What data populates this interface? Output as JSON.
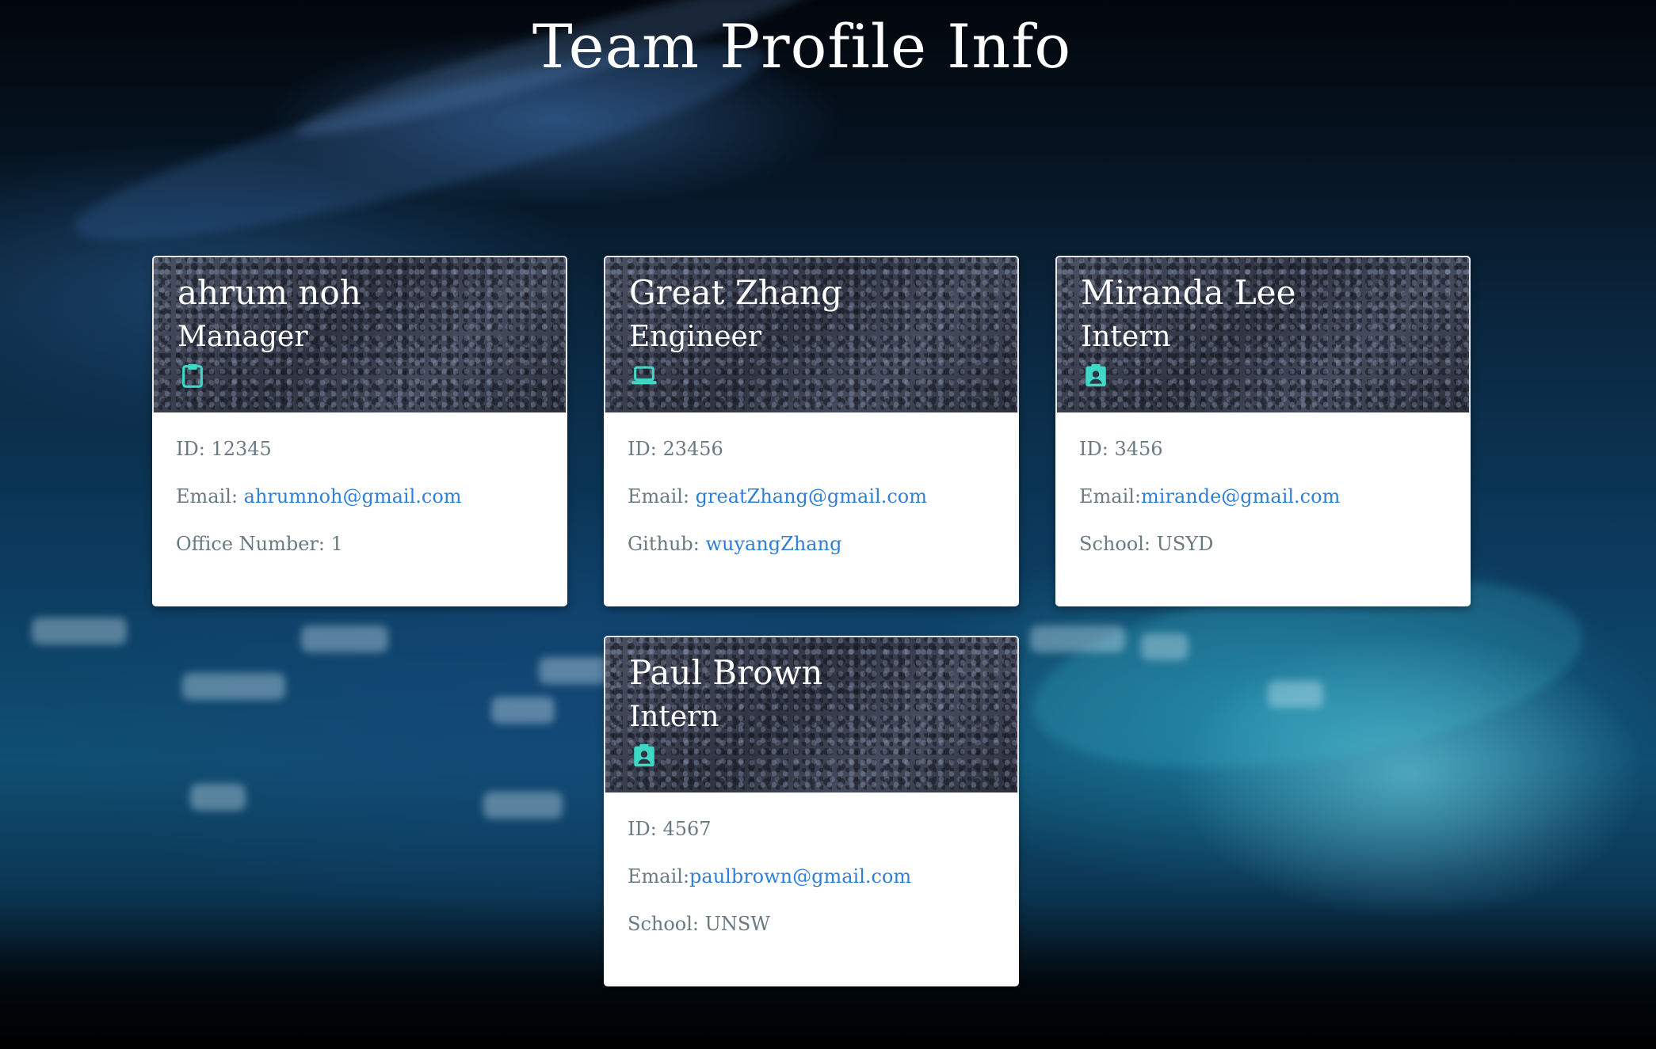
{
  "page": {
    "title": "Team Profile Info"
  },
  "theme": {
    "icon_color": "#3dd9c6",
    "link_color": "#2f7fd6",
    "text_color": "#6a7a82"
  },
  "cards": [
    {
      "name": "ahrum noh",
      "role": "Manager",
      "icon": "clipboard-icon",
      "id_label": "ID: 12345",
      "email_prefix": "Email: ",
      "email": "ahrumnoh@gmail.com",
      "extra_prefix": "Office Number: 1",
      "extra_value": ""
    },
    {
      "name": "Great Zhang",
      "role": "Engineer",
      "icon": "laptop-icon",
      "id_label": "ID: 23456",
      "email_prefix": "Email: ",
      "email": "greatZhang@gmail.com",
      "extra_prefix": "Github: ",
      "extra_value": "wuyangZhang"
    },
    {
      "name": "Miranda Lee",
      "role": "Intern",
      "icon": "badge-icon",
      "id_label": "ID: 3456",
      "email_prefix": "Email:",
      "email": "mirande@gmail.com",
      "extra_prefix": "School: USYD",
      "extra_value": ""
    },
    {
      "name": "Paul Brown",
      "role": "Intern",
      "icon": "badge-icon",
      "id_label": "ID: 4567",
      "email_prefix": "Email:",
      "email": "paulbrown@gmail.com",
      "extra_prefix": "School: UNSW",
      "extra_value": ""
    }
  ]
}
